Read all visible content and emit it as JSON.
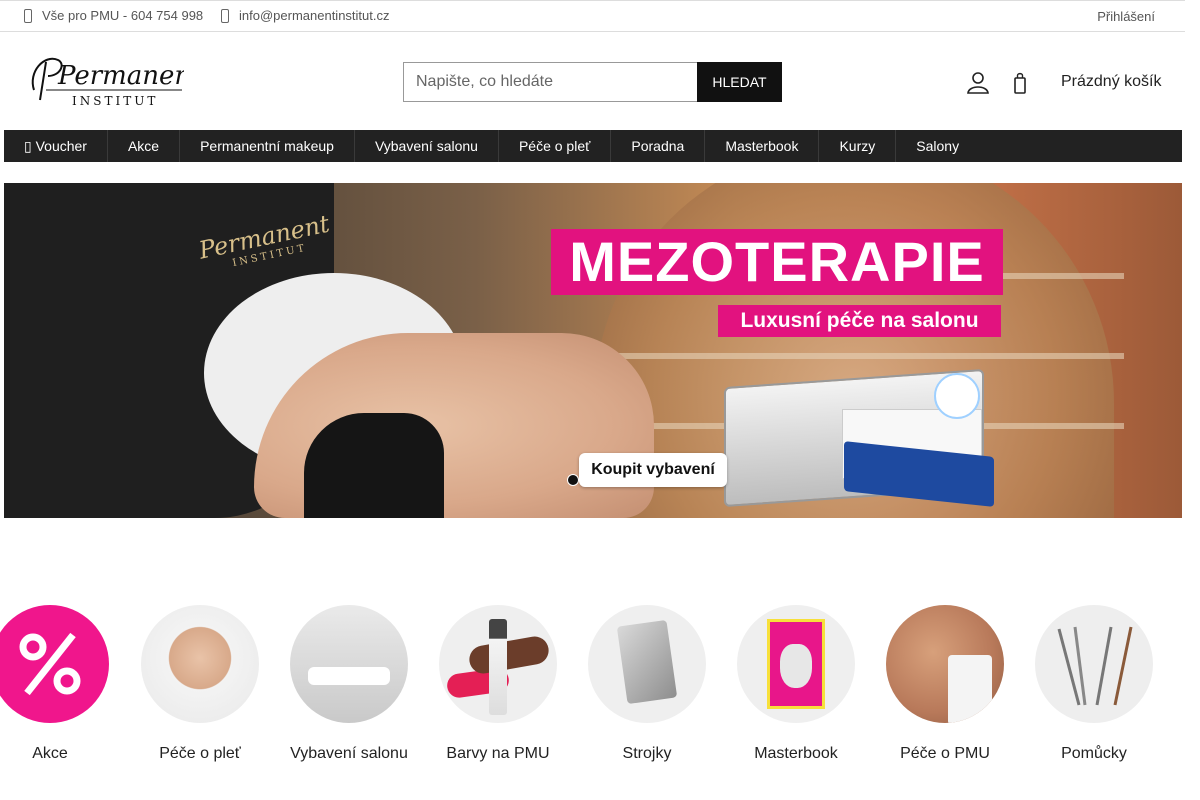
{
  "topbar": {
    "phone": "Vše pro PMU - 604 754 998",
    "email": "info@permanentinstitut.cz",
    "login": "Přihlášení"
  },
  "header": {
    "logo_text": "Permanent",
    "logo_sub": "INSTITUT",
    "search_placeholder": "Napište, co hledáte",
    "search_button": "HLEDAT",
    "cart_label": "Prázdný košík"
  },
  "nav": {
    "items": [
      "Voucher",
      "Akce",
      "Permanentní makeup",
      "Vybavení salonu",
      "Péče o pleť",
      "Poradna",
      "Masterbook",
      "Kurzy",
      "Salony"
    ]
  },
  "hero": {
    "brand": "Permanent",
    "brand_sub": "INSTITUT",
    "title": "MEZOTERAPIE",
    "subtitle": "Luxusní péče na salonu",
    "cta": "Koupit vybavení",
    "slides": 3,
    "active_slide": 1
  },
  "categories": [
    {
      "label": "Akce"
    },
    {
      "label": "Péče o pleť"
    },
    {
      "label": "Vybavení salonu"
    },
    {
      "label": "Barvy na PMU"
    },
    {
      "label": "Strojky"
    },
    {
      "label": "Masterbook"
    },
    {
      "label": "Péče o PMU"
    },
    {
      "label": "Pomůcky"
    }
  ],
  "colors": {
    "accent_pink": "#e2127f",
    "nav_bg": "#222222",
    "button_bg": "#111111"
  }
}
